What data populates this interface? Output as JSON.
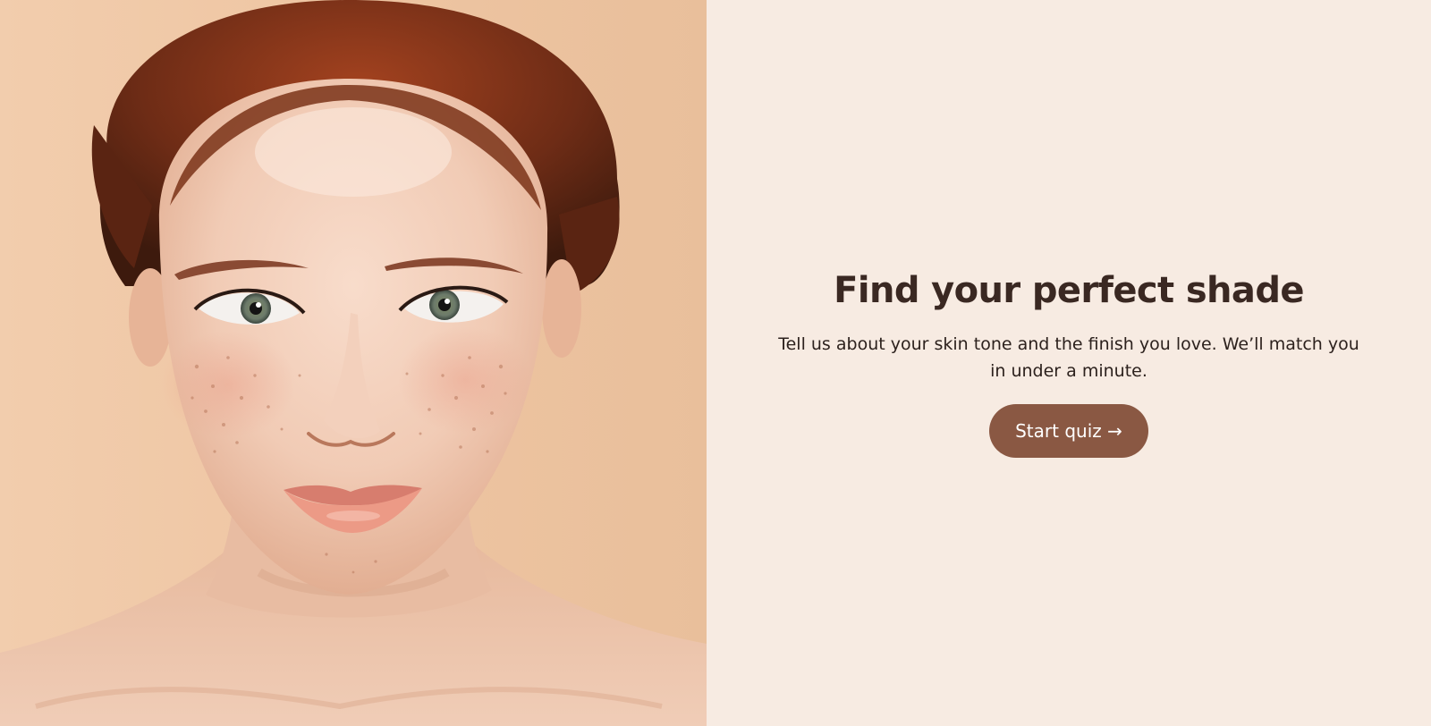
{
  "hero": {
    "headline": "Find your perfect shade",
    "subtext": "Tell us about your skin tone and the finish you love. We’ll match you in under a minute.",
    "cta_label": "Start quiz →"
  },
  "colors": {
    "panel_background": "#f7ebe2",
    "headline": "#3a2822",
    "body_text": "#2c211d",
    "button_background": "#8a5843",
    "button_text": "#ffffff",
    "photo_background": "#eec4a0"
  },
  "icons": {
    "cta_arrow": "right-arrow-icon"
  }
}
